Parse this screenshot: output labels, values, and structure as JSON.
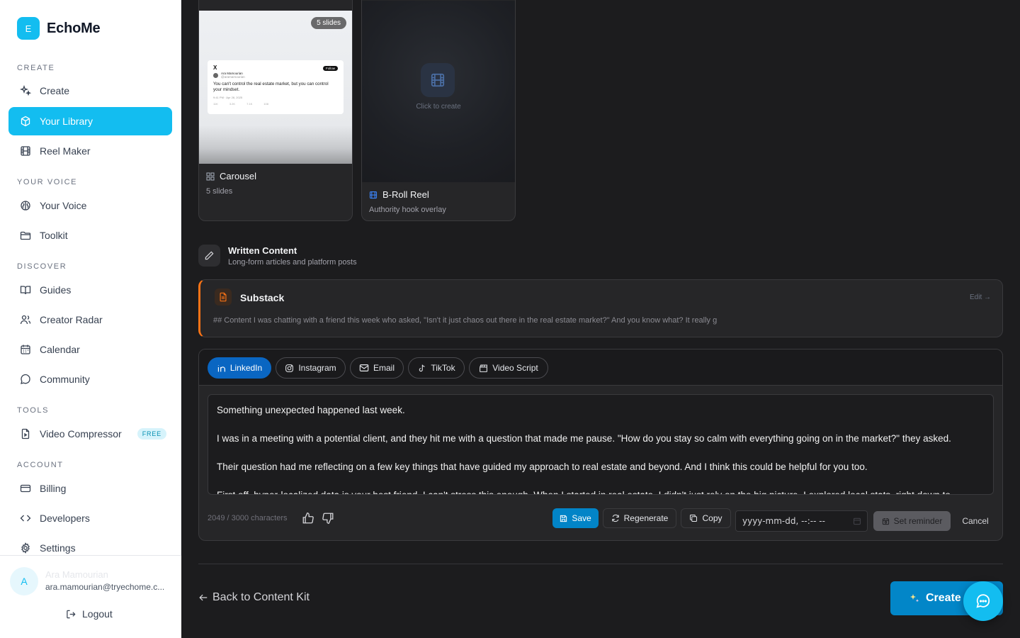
{
  "brand": {
    "logo_letter": "E",
    "name": "EchoMe"
  },
  "sidebar": {
    "sections": {
      "create": "CREATE",
      "your_voice": "YOUR VOICE",
      "discover": "DISCOVER",
      "tools": "TOOLS",
      "account": "ACCOUNT"
    },
    "items": {
      "create": "Create",
      "library": "Your Library",
      "reel_maker": "Reel Maker",
      "your_voice": "Your Voice",
      "toolkit": "Toolkit",
      "guides": "Guides",
      "creator_radar": "Creator Radar",
      "calendar": "Calendar",
      "community": "Community",
      "video_compressor": "Video Compressor",
      "free_badge": "FREE",
      "billing": "Billing",
      "developers": "Developers",
      "settings": "Settings"
    },
    "active_item": "Your Library",
    "user": {
      "avatar_letter": "A",
      "name": "Ara Mamourian",
      "email": "ara.mamourian@tryechome.c..."
    },
    "logout": "Logout"
  },
  "carousel_card": {
    "badge": "5 slides",
    "title": "Carousel",
    "subtitle": "5 slides",
    "tweet": {
      "x_logo": "X",
      "follow": "Follow",
      "name": "Ara Mamourian",
      "handle": "@aramamourian",
      "text": "You can't control the real estate market, but you can control your mindset.",
      "meta": "9:41 PM · Apr 28, 2025",
      "stats": [
        "11K",
        "3.2K",
        "7.1K",
        "108"
      ]
    }
  },
  "broll_card": {
    "hint": "Click to create",
    "title": "B-Roll Reel",
    "subtitle": "Authority hook overlay"
  },
  "written_content": {
    "title": "Written Content",
    "subtitle": "Long-form articles and platform posts"
  },
  "substack": {
    "title": "Substack",
    "edit": "Edit →",
    "preview": "## Content I was chatting with a friend this week who asked, \"Isn't it just chaos out there in the real estate market?\" And you know what? It really g"
  },
  "editor": {
    "tabs": [
      "LinkedIn",
      "Instagram",
      "Email",
      "TikTok",
      "Video Script"
    ],
    "active_tab": "LinkedIn",
    "paragraphs": [
      "Something unexpected happened last week.",
      "I was in a meeting with a potential client, and they hit me with a question that made me pause. \"How do you stay so calm with everything going on in the market?\" they asked.",
      "Their question had me reflecting on a few key things that have guided my approach to real estate and beyond. And I think this could be helpful for you too.",
      "First off, hyper-localized data is your best friend. I can't stress this enough. When I started in real estate, I didn't just rely on the big picture. I explored local stats, right down to"
    ],
    "char_count": "2049 / 3000 characters",
    "save": "Save",
    "regenerate": "Regenerate",
    "copy": "Copy",
    "date_placeholder": "yyyy-mm-dd, --:-- --",
    "set_reminder": "Set reminder",
    "cancel": "Cancel"
  },
  "footer": {
    "back": "Back to Content Kit",
    "create": "Create"
  },
  "colors": {
    "accent": "#13bdf0",
    "linkedin": "#0a66c2",
    "save": "#0284c7",
    "substack": "#f97316"
  }
}
